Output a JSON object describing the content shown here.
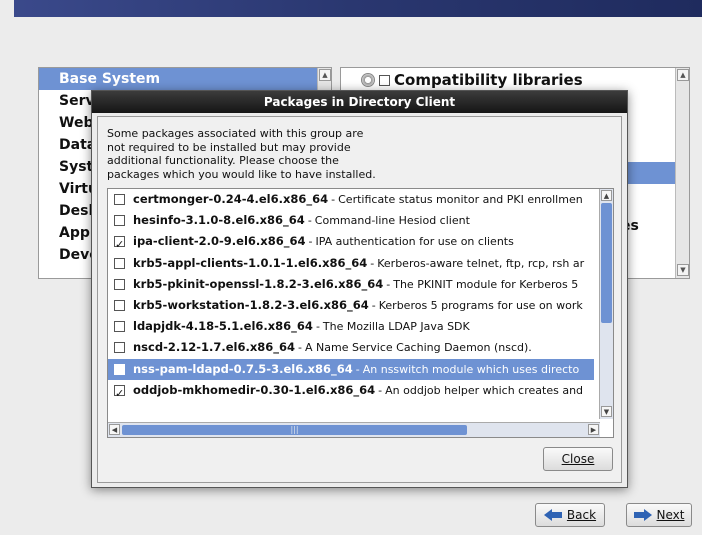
{
  "group_list": {
    "items": [
      {
        "label": "Base System",
        "selected": true
      },
      {
        "label": "Serv",
        "selected": false
      },
      {
        "label": "Web",
        "selected": false
      },
      {
        "label": "Data",
        "selected": false
      },
      {
        "label": "Syst",
        "selected": false
      },
      {
        "label": "Virtu",
        "selected": false
      },
      {
        "label": "Desk",
        "selected": false
      },
      {
        "label": "Appl",
        "selected": false
      },
      {
        "label": "Deve",
        "selected": false
      }
    ]
  },
  "subgroup_list": {
    "first_item": "Compatibility libraries",
    "peek_text": "es"
  },
  "dialog": {
    "title": "Packages in Directory Client",
    "intro_lines": [
      "Some packages associated with this group are",
      "not required to be installed but may provide",
      "additional functionality.  Please choose the",
      "packages which you would like to have installed."
    ],
    "packages": [
      {
        "name": "certmonger-0.24-4.el6.x86_64",
        "desc": "Certificate status monitor and PKI enrollmen",
        "checked": false,
        "selected": false
      },
      {
        "name": "hesinfo-3.1.0-8.el6.x86_64",
        "desc": "Command-line Hesiod client",
        "checked": false,
        "selected": false
      },
      {
        "name": "ipa-client-2.0-9.el6.x86_64",
        "desc": "IPA authentication for use on clients",
        "checked": true,
        "selected": false
      },
      {
        "name": "krb5-appl-clients-1.0.1-1.el6.x86_64",
        "desc": "Kerberos-aware telnet, ftp, rcp, rsh ar",
        "checked": false,
        "selected": false
      },
      {
        "name": "krb5-pkinit-openssl-1.8.2-3.el6.x86_64",
        "desc": "The PKINIT module for Kerberos 5",
        "checked": false,
        "selected": false
      },
      {
        "name": "krb5-workstation-1.8.2-3.el6.x86_64",
        "desc": "Kerberos 5 programs for use on work",
        "checked": false,
        "selected": false
      },
      {
        "name": "ldapjdk-4.18-5.1.el6.x86_64",
        "desc": "The Mozilla LDAP Java SDK",
        "checked": false,
        "selected": false
      },
      {
        "name": "nscd-2.12-1.7.el6.x86_64",
        "desc": "A Name Service Caching Daemon (nscd).",
        "checked": false,
        "selected": false
      },
      {
        "name": "nss-pam-ldapd-0.7.5-3.el6.x86_64",
        "desc": "An nsswitch module which uses directo",
        "checked": true,
        "selected": true
      },
      {
        "name": "oddjob-mkhomedir-0.30-1.el6.x86_64",
        "desc": "An oddjob helper which creates and",
        "checked": true,
        "selected": false
      }
    ],
    "close_label": "Close"
  },
  "nav": {
    "back_label": "Back",
    "next_label": "Next"
  },
  "colors": {
    "selection": "#6e92d3",
    "title_bar": "#1a1a1a",
    "arrow": "#2f63b4"
  },
  "icons": {
    "back": "arrow-left-icon",
    "next": "arrow-right-icon",
    "group": "gear-icon"
  }
}
